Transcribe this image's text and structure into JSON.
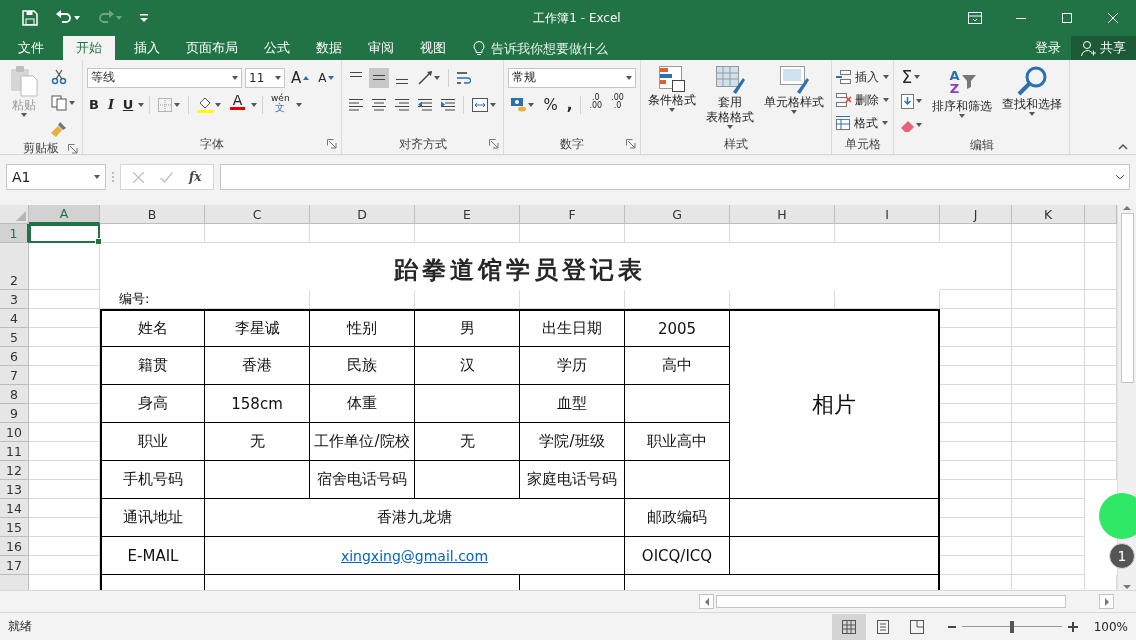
{
  "title_bar": {
    "title": "工作簿1 - Excel",
    "quick_access": [
      {
        "kind": "save",
        "disabled": false
      },
      {
        "kind": "undo",
        "disabled": false
      },
      {
        "kind": "redo",
        "disabled": true
      },
      {
        "kind": "customize",
        "disabled": false
      }
    ]
  },
  "tabs": [
    {
      "label": "文件",
      "selected": false
    },
    {
      "label": "开始",
      "selected": true
    },
    {
      "label": "插入",
      "selected": false
    },
    {
      "label": "页面布局",
      "selected": false
    },
    {
      "label": "公式",
      "selected": false
    },
    {
      "label": "数据",
      "selected": false
    },
    {
      "label": "审阅",
      "selected": false
    },
    {
      "label": "视图",
      "selected": false
    }
  ],
  "tell_me": {
    "placeholder": "告诉我你想要做什么"
  },
  "account": {
    "sign_in": "登录",
    "share": "共享"
  },
  "ribbon": {
    "groups": [
      {
        "kind": "clipboard",
        "label": "剪贴板",
        "launcher": true,
        "paste": "粘贴"
      },
      {
        "kind": "font",
        "label": "字体",
        "launcher": true,
        "font": "等线",
        "size": "11",
        "grow": "A",
        "shrink": "A",
        "bold": "B",
        "italic": "I",
        "underline": "U",
        "font_color": "A",
        "pinyin": "wén",
        "hanzi": "文"
      },
      {
        "kind": "alignment",
        "label": "对齐方式",
        "launcher": true,
        "vertical": [
          {
            "kind": "top",
            "selected": false
          },
          {
            "kind": "middle",
            "selected": true
          },
          {
            "kind": "bottom",
            "selected": false
          }
        ]
      },
      {
        "kind": "number",
        "label": "数字",
        "launcher": true,
        "format": "常规",
        "percent": "%",
        "comma": ",",
        "inc_decimal": [
          ".0",
          ".00"
        ],
        "dec_decimal": [
          ".00",
          ".0"
        ]
      },
      {
        "kind": "styles",
        "label": "样式",
        "launcher": false,
        "buttons": [
          {
            "kind": "conditional",
            "lines": [
              "条件格式"
            ]
          },
          {
            "kind": "table",
            "lines": [
              "套用",
              "表格格式"
            ]
          },
          {
            "kind": "cell",
            "lines": [
              "单元格样式"
            ]
          }
        ]
      },
      {
        "kind": "cells",
        "label": "单元格",
        "launcher": false,
        "buttons": [
          {
            "kind": "insert",
            "label": "插入"
          },
          {
            "kind": "delete",
            "label": "删除"
          },
          {
            "kind": "format",
            "label": "格式"
          }
        ]
      },
      {
        "kind": "editing",
        "label": "编辑",
        "launcher": false,
        "sum": "Σ",
        "sort_letters": [
          "A",
          "Z"
        ],
        "sort": "排序和筛选",
        "find": "查找和选择"
      }
    ]
  },
  "formula_bar": {
    "name_box": "A1",
    "function": "fx"
  },
  "sheet": {
    "columns": [
      {
        "label": "A",
        "selected": true
      },
      {
        "label": "B",
        "selected": false
      },
      {
        "label": "C",
        "selected": false
      },
      {
        "label": "D",
        "selected": false
      },
      {
        "label": "E",
        "selected": false
      },
      {
        "label": "F",
        "selected": false
      },
      {
        "label": "G",
        "selected": false
      },
      {
        "label": "H",
        "selected": false
      },
      {
        "label": "I",
        "selected": false
      },
      {
        "label": "J",
        "selected": false
      },
      {
        "label": "K",
        "selected": false
      }
    ],
    "rows": [
      {
        "label": "1",
        "selected": true
      },
      {
        "label": "2",
        "selected": false
      },
      {
        "label": "3",
        "selected": false
      },
      {
        "label": "4",
        "selected": false
      },
      {
        "label": "5",
        "selected": false
      },
      {
        "label": "6",
        "selected": false
      },
      {
        "label": "7",
        "selected": false
      },
      {
        "label": "8",
        "selected": false
      },
      {
        "label": "9",
        "selected": false
      },
      {
        "label": "10",
        "selected": false
      },
      {
        "label": "11",
        "selected": false
      },
      {
        "label": "12",
        "selected": false
      },
      {
        "label": "13",
        "selected": false
      },
      {
        "label": "14",
        "selected": false
      },
      {
        "label": "15",
        "selected": false
      },
      {
        "label": "16",
        "selected": false
      },
      {
        "label": "17",
        "selected": false
      }
    ],
    "title": "跆拳道馆学员登记表",
    "number_label": "编号:",
    "form": {
      "photo": "相片",
      "rows": [
        {
          "kind": "pairs",
          "fields": [
            {
              "label": "姓名",
              "value": "李星诚"
            },
            {
              "label": "性别",
              "value": "男"
            },
            {
              "label": "出生日期",
              "value": "2005"
            }
          ]
        },
        {
          "kind": "pairs",
          "fields": [
            {
              "label": "籍贯",
              "value": "香港"
            },
            {
              "label": "民族",
              "value": "汉"
            },
            {
              "label": "学历",
              "value": "高中"
            }
          ]
        },
        {
          "kind": "pairs",
          "fields": [
            {
              "label": "身高",
              "value": "158cm"
            },
            {
              "label": "体重"
            },
            {
              "label": "血型"
            }
          ]
        },
        {
          "kind": "pairs",
          "fields": [
            {
              "label": "职业",
              "value": "无"
            },
            {
              "label": "工作单位/院校",
              "value": "无"
            },
            {
              "label": "学院/班级",
              "value": "职业高中"
            }
          ]
        },
        {
          "kind": "pairs",
          "fields": [
            {
              "label": "手机号码"
            },
            {
              "label": "宿舍电话号码"
            },
            {
              "label": "家庭电话号码"
            }
          ]
        },
        {
          "kind": "wide",
          "fields": [
            {
              "label": "通讯地址",
              "value": "香港九龙塘"
            },
            {
              "label": "邮政编码"
            }
          ]
        },
        {
          "kind": "wide",
          "fields": [
            {
              "label": "E-MAIL",
              "value": "xingxing@gmail.com",
              "kind": "link"
            },
            {
              "label": "OICQ/ICQ"
            }
          ]
        },
        {
          "kind": "blank"
        }
      ]
    }
  },
  "status_bar": {
    "status": "就绪",
    "views": [
      {
        "kind": "normal",
        "selected": true
      },
      {
        "kind": "page_layout",
        "selected": false
      },
      {
        "kind": "page_break",
        "selected": false
      }
    ],
    "zoom": {
      "level": 0.5,
      "reading": "100%"
    }
  },
  "overlay": {
    "badge": "1"
  }
}
